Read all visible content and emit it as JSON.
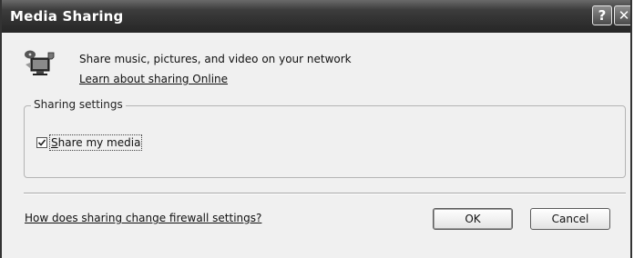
{
  "window": {
    "title": "Media Sharing",
    "help_glyph": "?",
    "close_glyph": "✕"
  },
  "header": {
    "description": "Share music, pictures, and video on your network",
    "learn_link": "Learn about sharing Online",
    "icon": "media-sharing-icon"
  },
  "sharing_settings": {
    "legend": "Sharing settings",
    "share_checkbox": {
      "mnemonic": "S",
      "label_rest": "hare my media",
      "checked": true
    }
  },
  "footer": {
    "firewall_link": "How does sharing change firewall settings?",
    "ok_label": "OK",
    "cancel_label": "Cancel"
  }
}
